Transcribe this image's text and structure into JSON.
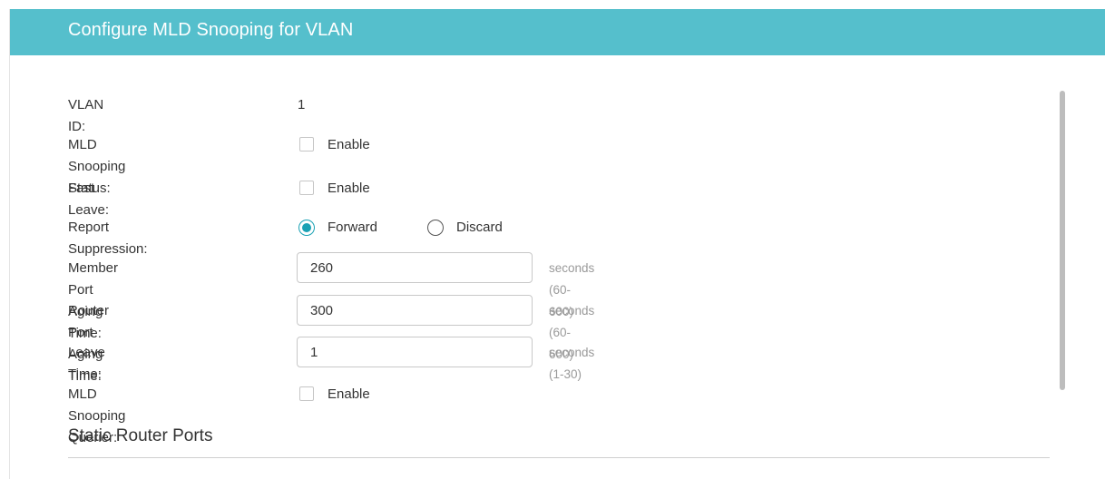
{
  "dialog": {
    "title": "Configure MLD Snooping for VLAN"
  },
  "form": {
    "vlan_id": {
      "label": "VLAN ID:",
      "value": "1"
    },
    "mld_snooping_status": {
      "label": "MLD Snooping Status:",
      "option_label": "Enable",
      "checked": false
    },
    "fast_leave": {
      "label": "Fast Leave:",
      "option_label": "Enable",
      "checked": false
    },
    "report_suppression": {
      "label": "Report Suppression:",
      "options": [
        {
          "label": "Forward",
          "selected": true
        },
        {
          "label": "Discard",
          "selected": false
        }
      ]
    },
    "member_port_aging_time": {
      "label": "Member Port Aging Time:",
      "value": "260",
      "hint": "seconds (60-600)"
    },
    "router_port_aging_time": {
      "label": "Router Port Aging Time:",
      "value": "300",
      "hint": "seconds (60-600)"
    },
    "leave_time": {
      "label": "Leave Time:",
      "value": "1",
      "hint": "seconds (1-30)"
    },
    "mld_snooping_querier": {
      "label": "MLD Snooping Querier:",
      "option_label": "Enable",
      "checked": false
    }
  },
  "static_router_ports": {
    "title": "Static Router Ports"
  },
  "colors": {
    "header": "#55bfcc",
    "accent": "#1aa1b4"
  }
}
